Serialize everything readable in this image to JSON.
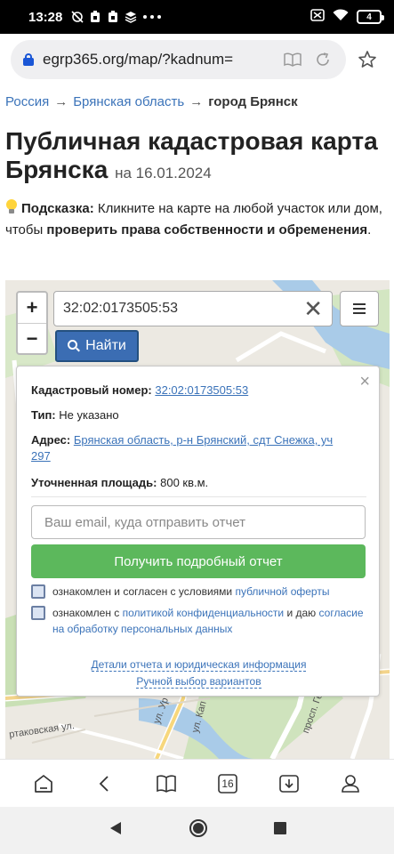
{
  "status": {
    "time": "13:28",
    "battery": "4"
  },
  "browser": {
    "url": "egrp365.org/map/?kadnum="
  },
  "breadcrumb": {
    "item1": "Россия",
    "arrow": "→",
    "item2": "Брянская область",
    "current": "город Брянск"
  },
  "title": {
    "main": "Публичная кадастровая карта Брянска",
    "date": "на 16.01.2024"
  },
  "hint": {
    "label": "Подсказка:",
    "text1": "Кликните на карте на любой участок или дом, чтобы",
    "bold": "проверить права собственности и обременения",
    "end": "."
  },
  "map": {
    "zoom_in": "+",
    "zoom_out": "−",
    "search_value": "32:02:0173505:53",
    "find_label": "Найти",
    "street_labels": [
      "ртаковская ул.",
      "ул. Ур",
      "ул. Кап",
      "просп. Гер"
    ]
  },
  "card": {
    "close": "×",
    "cad_label": "Кадастровый номер:",
    "cad_value": "32:02:0173505:53",
    "type_label": "Тип:",
    "type_value": "Не указано",
    "addr_label": "Адрес:",
    "addr_value": "Брянская область, р-н Брянский, сдт Снежка, уч 297",
    "area_label": "Уточненная площадь:",
    "area_value": "800 кв.м.",
    "email_placeholder": "Ваш email, куда отправить отчет",
    "get_report": "Получить подробный отчет",
    "consent1_text": "ознакомлен и согласен с условиями",
    "consent1_link": "публичной оферты",
    "consent2_text1": "ознакомлен с",
    "consent2_link1": "политикой конфиденциальности",
    "consent2_text2": "и даю",
    "consent2_link2": "согласие на обработку персональных данных",
    "details_link": "Детали отчета и юридическая информация",
    "manual_link": "Ручной выбор вариантов"
  },
  "bottom_nav": {
    "tabs_count": "16"
  }
}
